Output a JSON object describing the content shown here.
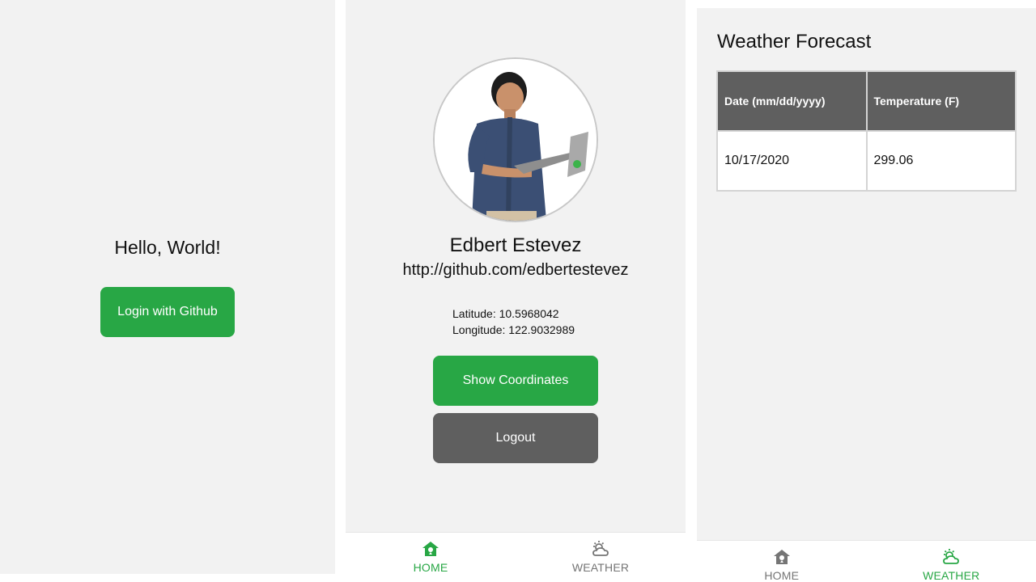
{
  "login_screen": {
    "greeting": "Hello, World!",
    "login_button": "Login with Github"
  },
  "profile_screen": {
    "name": "Edbert Estevez",
    "url": "http://github.com/edbertestevez",
    "latitude": "Latitude: 10.5968042",
    "longitude": "Longitude: 122.9032989",
    "show_coordinates_button": "Show Coordinates",
    "logout_button": "Logout",
    "nav": {
      "home": "HOME",
      "weather": "WEATHER",
      "active": "home"
    }
  },
  "weather_screen": {
    "title": "Weather Forecast",
    "table": {
      "headers": [
        "Date (mm/dd/yyyy)",
        "Temperature (F)"
      ],
      "rows": [
        [
          "10/17/2020",
          "299.06"
        ]
      ]
    },
    "nav": {
      "home": "HOME",
      "weather": "WEATHER",
      "active": "weather"
    }
  },
  "icons": {
    "home": "home-icon",
    "weather": "weather-icon"
  },
  "colors": {
    "accent": "#28a745",
    "secondary_button": "#5f5f5f",
    "background": "#f2f2f2",
    "inactive_nav": "#757575"
  }
}
